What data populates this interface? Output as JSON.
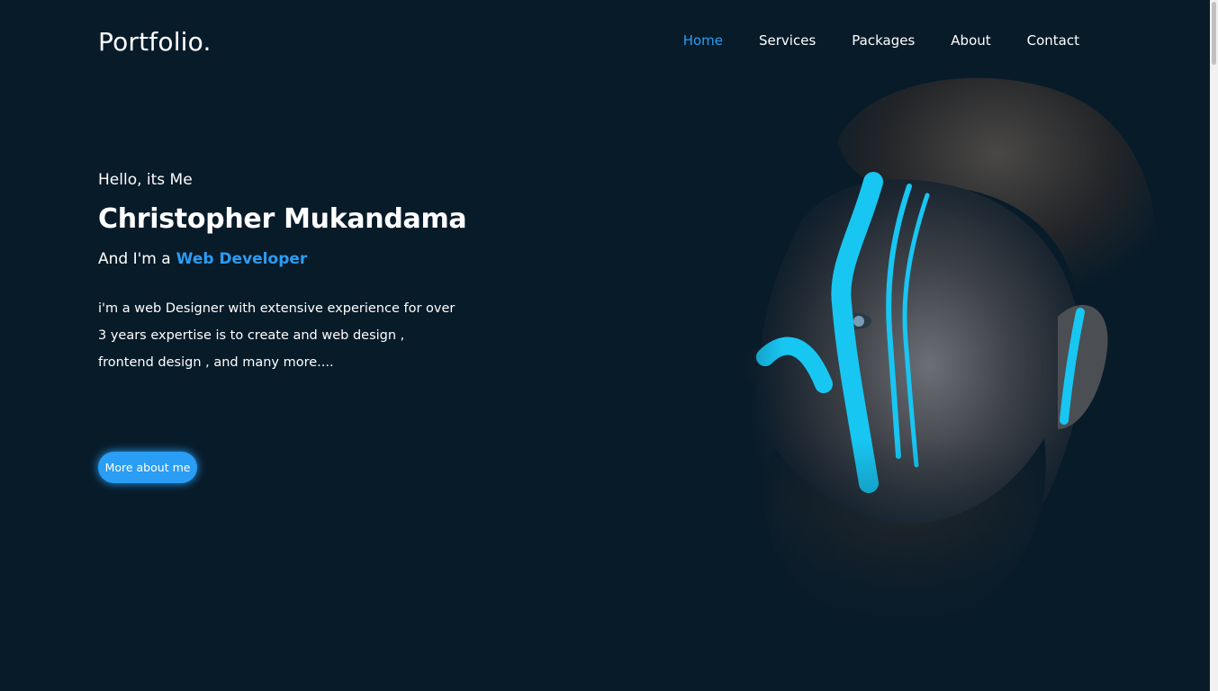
{
  "header": {
    "logo": "Portfolio.",
    "nav": [
      {
        "label": "Home",
        "active": true
      },
      {
        "label": "Services",
        "active": false
      },
      {
        "label": "Packages",
        "active": false
      },
      {
        "label": "About",
        "active": false
      },
      {
        "label": "Contact",
        "active": false
      }
    ]
  },
  "hero": {
    "greeting": "Hello, its Me",
    "name": "Christopher Mukandama",
    "role_prefix": "And I'm a",
    "role_highlight": "Web Developer",
    "description": "i'm a web Designer with extensive experience for over 3 years expertise is to create and web design , frontend design , and many more....",
    "cta_label": "More about me",
    "image": "portrait-face-paint-image"
  },
  "colors": {
    "background": "#081b29",
    "accent": "#2a9df4",
    "text": "#ffffff"
  }
}
